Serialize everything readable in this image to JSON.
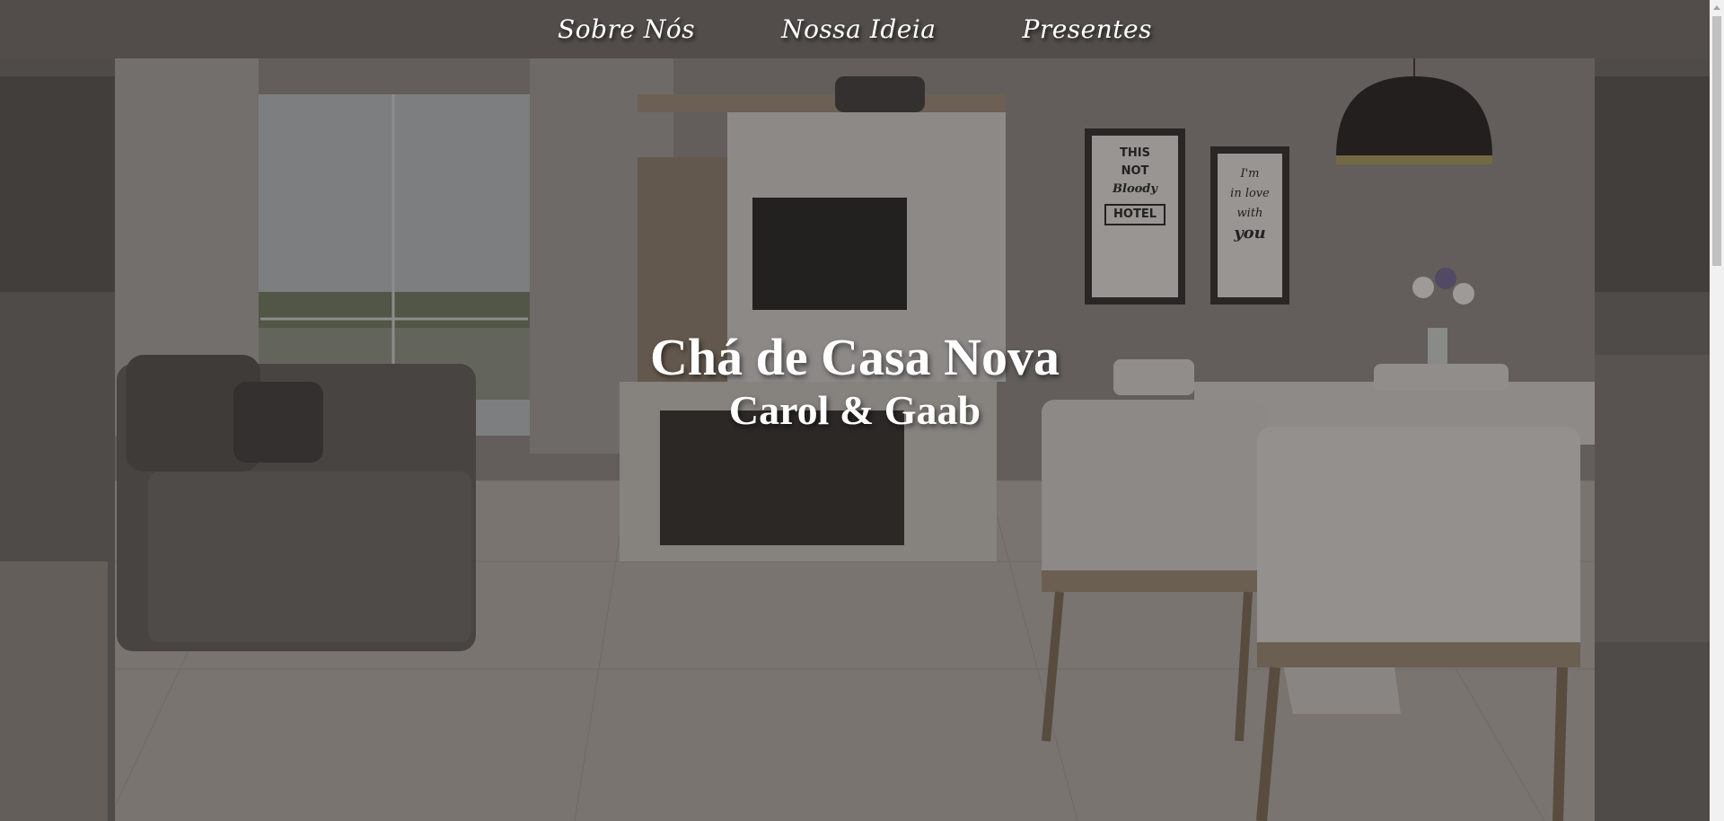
{
  "nav": {
    "items": [
      {
        "label": "Sobre Nós"
      },
      {
        "label": "Nossa Ideia"
      },
      {
        "label": "Presentes"
      }
    ]
  },
  "hero": {
    "title": "Chá de Casa Nova",
    "subtitle": "Carol & Gaab"
  },
  "scene": {
    "posters": [
      {
        "lines": [
          "THIS",
          "NOT",
          "Bloody",
          "HOTEL"
        ]
      },
      {
        "lines": [
          "I'm",
          "in love",
          "with",
          "you"
        ]
      }
    ]
  },
  "colors": {
    "nav_background": "#524d4a",
    "nav_text": "#ffffff",
    "hero_text": "#ffffff"
  }
}
